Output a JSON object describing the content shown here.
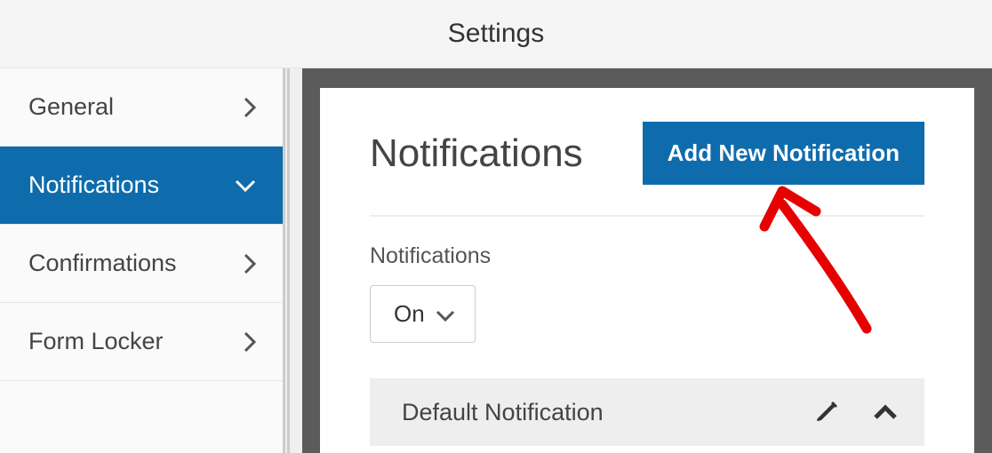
{
  "header": {
    "title": "Settings"
  },
  "sidebar": {
    "items": [
      {
        "label": "General"
      },
      {
        "label": "Notifications"
      },
      {
        "label": "Confirmations"
      },
      {
        "label": "Form Locker"
      }
    ]
  },
  "panel": {
    "title": "Notifications",
    "add_button": "Add New Notification",
    "toggle": {
      "label": "Notifications",
      "value": "On"
    },
    "list": [
      {
        "title": "Default Notification"
      }
    ]
  }
}
